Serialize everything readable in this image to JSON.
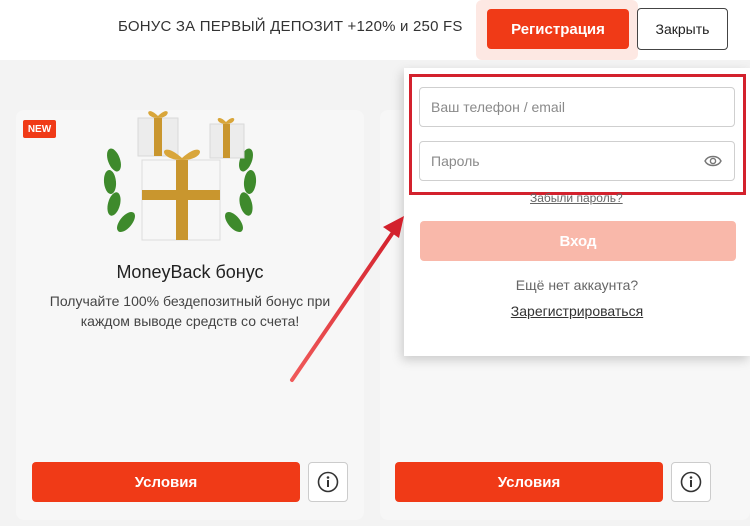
{
  "header": {
    "promo_text": "БОНУС ЗА ПЕРВЫЙ ДЕПОЗИТ +120% и 250 FS",
    "register_label": "Регистрация",
    "close_label": "Закрыть"
  },
  "cards": [
    {
      "badge": "NEW",
      "title": "MoneyBack бонус",
      "description": "Получайте 100% бездепозитный бонус при каждом выводе средств со счета!",
      "conditions_label": "Условия"
    },
    {
      "conditions_label": "Условия"
    }
  ],
  "login": {
    "phone_placeholder": "Ваш телефон / email",
    "password_placeholder": "Пароль",
    "forgot_label": "Забыли пароль?",
    "login_label": "Вход",
    "no_account_text": "Ещё нет аккаунта?",
    "register_link": "Зарегистрироваться"
  },
  "colors": {
    "accent": "#f03a17",
    "accent_disabled": "#f9b8aa",
    "highlight": "#d3212d"
  }
}
